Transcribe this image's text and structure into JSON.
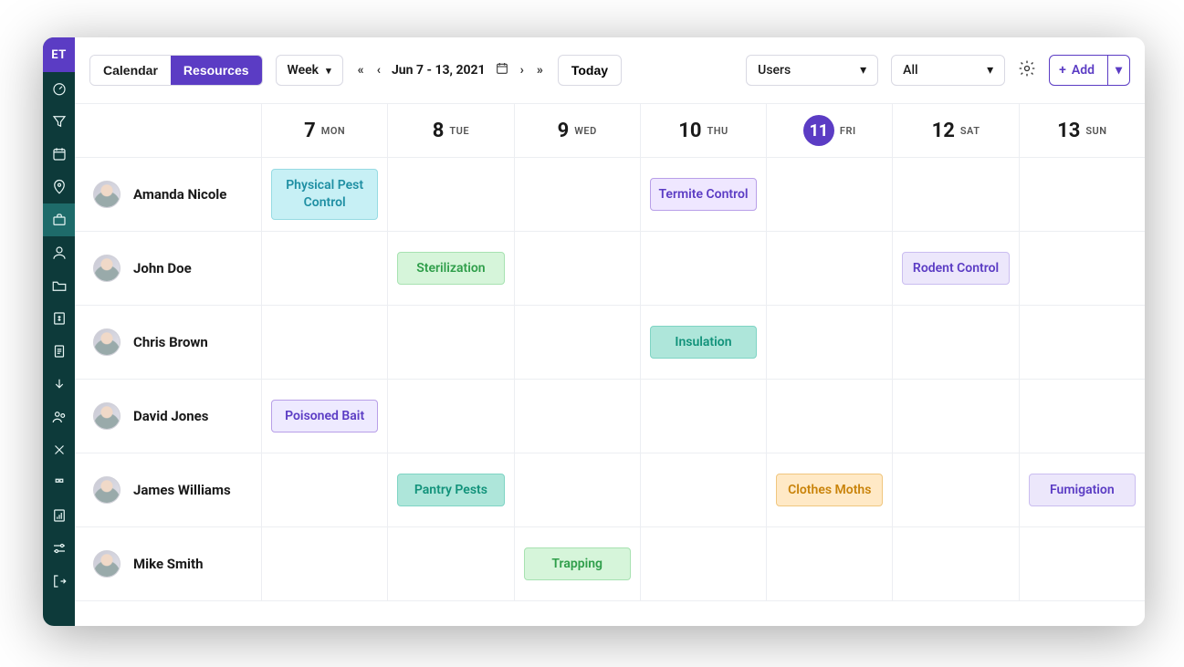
{
  "sidebar": {
    "logo": "ET",
    "items": [
      {
        "name": "dashboard-icon"
      },
      {
        "name": "funnel-icon"
      },
      {
        "name": "calendar-icon"
      },
      {
        "name": "map-icon"
      },
      {
        "name": "briefcase-icon",
        "active": true
      },
      {
        "name": "user-icon"
      },
      {
        "name": "folder-icon"
      },
      {
        "name": "dollar-icon"
      },
      {
        "name": "document-icon"
      },
      {
        "name": "handshake-icon"
      },
      {
        "name": "team-icon"
      },
      {
        "name": "tools-icon"
      },
      {
        "name": "quote-icon"
      },
      {
        "name": "report-icon"
      },
      {
        "name": "settings-icon"
      },
      {
        "name": "logout-icon"
      }
    ]
  },
  "toolbar": {
    "tabs": {
      "calendar": "Calendar",
      "resources": "Resources",
      "active": "resources"
    },
    "viewSelect": "Week",
    "range": "Jun 7 - 13, 2021",
    "today": "Today",
    "groupBy": "Users",
    "filter": "All",
    "addLabel": "Add"
  },
  "days": [
    {
      "num": "7",
      "dow": "MON"
    },
    {
      "num": "8",
      "dow": "TUE"
    },
    {
      "num": "9",
      "dow": "WED"
    },
    {
      "num": "10",
      "dow": "THU"
    },
    {
      "num": "11",
      "dow": "FRI",
      "today": true
    },
    {
      "num": "12",
      "dow": "SAT"
    },
    {
      "num": "13",
      "dow": "SUN"
    }
  ],
  "resources": [
    {
      "name": "Amanda Nicole"
    },
    {
      "name": "John Doe"
    },
    {
      "name": "Chris Brown"
    },
    {
      "name": "David Jones"
    },
    {
      "name": "James Williams"
    },
    {
      "name": "Mike Smith"
    }
  ],
  "events": {
    "r0d0": {
      "label": "Physical Pest Control",
      "cls": "ev-cyan"
    },
    "r0d3": {
      "label": "Termite Control",
      "cls": "ev-purple"
    },
    "r1d1": {
      "label": "Sterilization",
      "cls": "ev-green"
    },
    "r1d5": {
      "label": "Rodent Control",
      "cls": "ev-lav"
    },
    "r2d3": {
      "label": "Insulation",
      "cls": "ev-teal"
    },
    "r3d0": {
      "label": "Poisoned Bait",
      "cls": "ev-purpleOutline"
    },
    "r4d1": {
      "label": "Pantry Pests",
      "cls": "ev-teal"
    },
    "r4d4": {
      "label": "Clothes Moths",
      "cls": "ev-orange"
    },
    "r4d6": {
      "label": "Fumigation",
      "cls": "ev-lav"
    },
    "r5d2": {
      "label": "Trapping",
      "cls": "ev-green"
    }
  }
}
